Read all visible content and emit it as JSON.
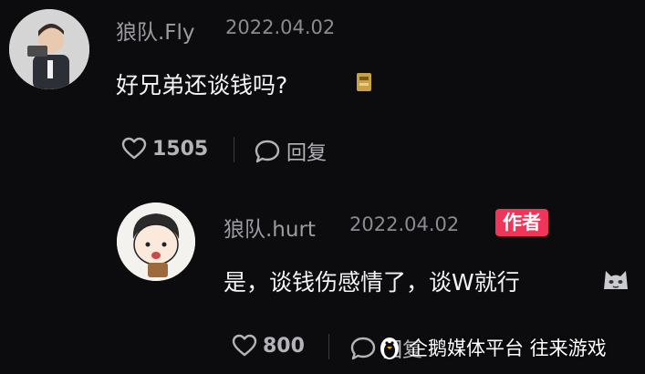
{
  "comment": {
    "username": "狼队.Fly",
    "date": "2022.04.02",
    "text": "好兄弟还谈钱吗?",
    "likes": "1505",
    "reply_label": "回复"
  },
  "reply": {
    "username": "狼队.hurt",
    "date": "2022.04.02",
    "badge": "作者",
    "text": "是，谈钱伤感情了，谈W就行",
    "likes": "800",
    "reply_label": "回复"
  },
  "watermark": {
    "text": "企鹅媒体平台 往来游戏"
  },
  "colors": {
    "background": "#0c0c0f",
    "badge": "#f0355a",
    "muted": "#9b9ca1"
  }
}
